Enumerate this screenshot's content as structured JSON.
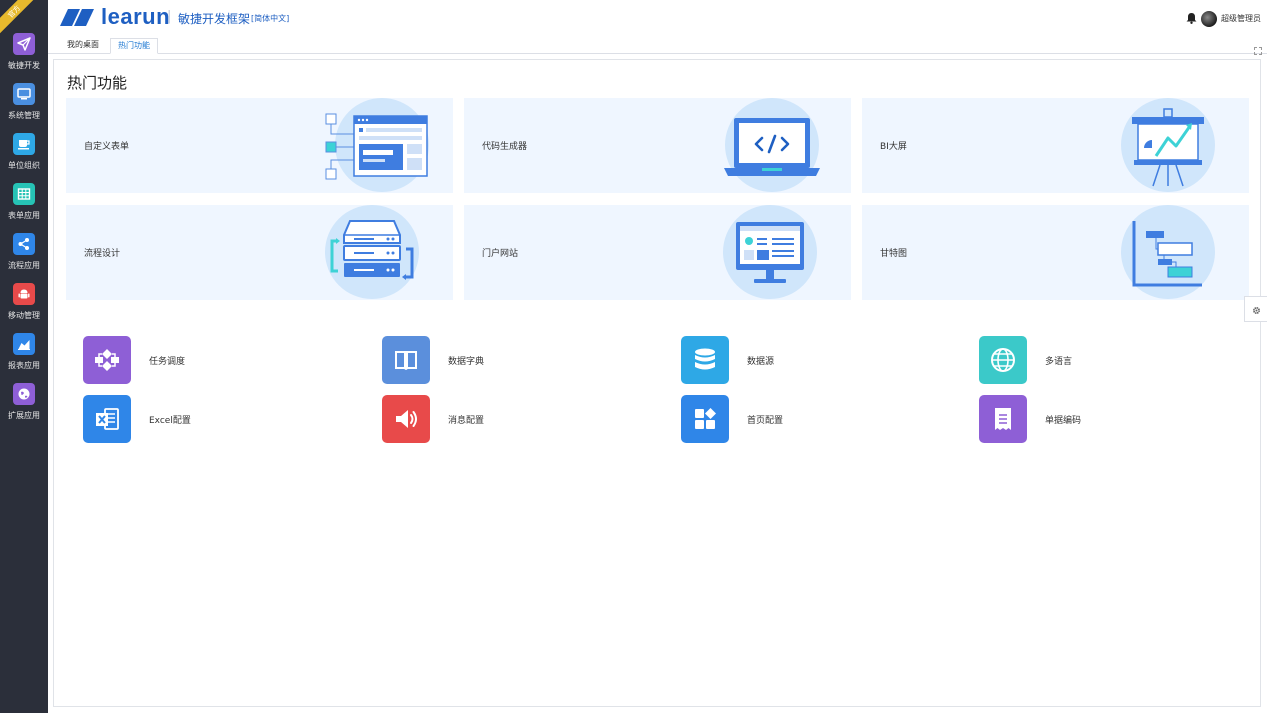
{
  "ribbon": "官方",
  "sidebar": {
    "items": [
      {
        "label": "敏捷开发",
        "icon": "paper-plane-icon",
        "color": "#8e5fd6"
      },
      {
        "label": "系统管理",
        "icon": "monitor-icon",
        "color": "#4a8fe0"
      },
      {
        "label": "单位组织",
        "icon": "coffee-cup-icon",
        "color": "#2ea8e6"
      },
      {
        "label": "表单应用",
        "icon": "grid-table-icon",
        "color": "#26c3b5"
      },
      {
        "label": "流程应用",
        "icon": "share-nodes-icon",
        "color": "#2f86e8"
      },
      {
        "label": "移动管理",
        "icon": "android-icon",
        "color": "#e84a4a"
      },
      {
        "label": "报表应用",
        "icon": "area-chart-icon",
        "color": "#2f86e8"
      },
      {
        "label": "扩展应用",
        "icon": "globe-icon",
        "color": "#8e5fd6"
      }
    ]
  },
  "header": {
    "logo": "learun",
    "separator": "|",
    "subtitle": "敏捷开发框架",
    "lang": "[简体中文]",
    "user": "超级管理员"
  },
  "tabs": [
    {
      "label": "我的桌面",
      "active": false
    },
    {
      "label": "热门功能",
      "active": true
    }
  ],
  "main": {
    "title": "热门功能",
    "features": [
      {
        "label": "自定义表单",
        "icon": "form-designer-illustration"
      },
      {
        "label": "代码生成器",
        "icon": "laptop-code-illustration"
      },
      {
        "label": "BI大屏",
        "icon": "presentation-board-illustration"
      },
      {
        "label": "流程设计",
        "icon": "server-flow-illustration"
      },
      {
        "label": "门户网站",
        "icon": "portal-monitor-illustration"
      },
      {
        "label": "甘特图",
        "icon": "gantt-chart-illustration"
      }
    ],
    "quick_links": [
      {
        "label": "任务调度",
        "icon": "flow-diagram-icon",
        "color": "#8e5fd6"
      },
      {
        "label": "数据字典",
        "icon": "book-icon",
        "color": "#5b8fdc"
      },
      {
        "label": "数据源",
        "icon": "database-icon",
        "color": "#2ea8e6"
      },
      {
        "label": "多语言",
        "icon": "globe-icon",
        "color": "#3bc9c9"
      },
      {
        "label": "Excel配置",
        "icon": "excel-icon",
        "color": "#2f86e8"
      },
      {
        "label": "消息配置",
        "icon": "speaker-icon",
        "color": "#e84a4a"
      },
      {
        "label": "首页配置",
        "icon": "dashboard-tiles-icon",
        "color": "#2f86e8"
      },
      {
        "label": "单据编码",
        "icon": "receipt-icon",
        "color": "#8e5fd6"
      }
    ]
  },
  "colors": {
    "sidebar_bg": "#2b2f3a",
    "brand": "#1e5fc2",
    "feature_bg": "#eff6ff",
    "illustration_circle": "#d0e6fb"
  }
}
